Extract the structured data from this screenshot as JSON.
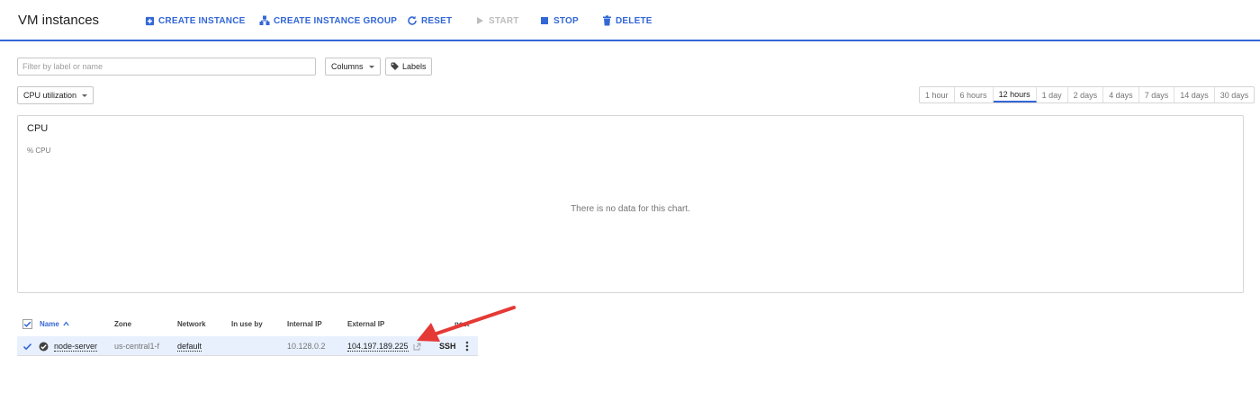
{
  "header": {
    "title": "VM instances",
    "actions": [
      {
        "label": "CREATE INSTANCE",
        "icon": "add-box-icon",
        "enabled": true
      },
      {
        "label": "CREATE INSTANCE GROUP",
        "icon": "instance-group-icon",
        "enabled": true
      },
      {
        "label": "RESET",
        "icon": "refresh-icon",
        "enabled": true
      },
      {
        "label": "START",
        "icon": "play-icon",
        "enabled": false
      },
      {
        "label": "STOP",
        "icon": "stop-icon",
        "enabled": true
      },
      {
        "label": "DELETE",
        "icon": "trash-icon",
        "enabled": true
      }
    ]
  },
  "filter": {
    "placeholder": "Filter by label or name",
    "columns_label": "Columns",
    "labels_label": "Labels"
  },
  "metric_select": {
    "value": "CPU utilization"
  },
  "time_ranges": {
    "options": [
      "1 hour",
      "6 hours",
      "12 hours",
      "1 day",
      "2 days",
      "4 days",
      "7 days",
      "14 days",
      "30 days"
    ],
    "selected": "12 hours"
  },
  "chart": {
    "title": "CPU",
    "ylabel": "% CPU",
    "empty_message": "There is no data for this chart."
  },
  "table": {
    "headers": {
      "name": "Name",
      "zone": "Zone",
      "network": "Network",
      "in_use_by": "In use by",
      "internal_ip": "Internal IP",
      "external_ip": "External IP",
      "connect": "nect"
    },
    "rows": [
      {
        "name": "node-server",
        "zone": "us-central1-f",
        "network": "default",
        "in_use_by": "",
        "internal_ip": "10.128.0.2",
        "external_ip": "104.197.189.225",
        "connect": "SSH"
      }
    ]
  },
  "colors": {
    "accent": "#3367d6",
    "annotation_arrow": "#e53935",
    "selected_row": "#e8f0fe"
  }
}
